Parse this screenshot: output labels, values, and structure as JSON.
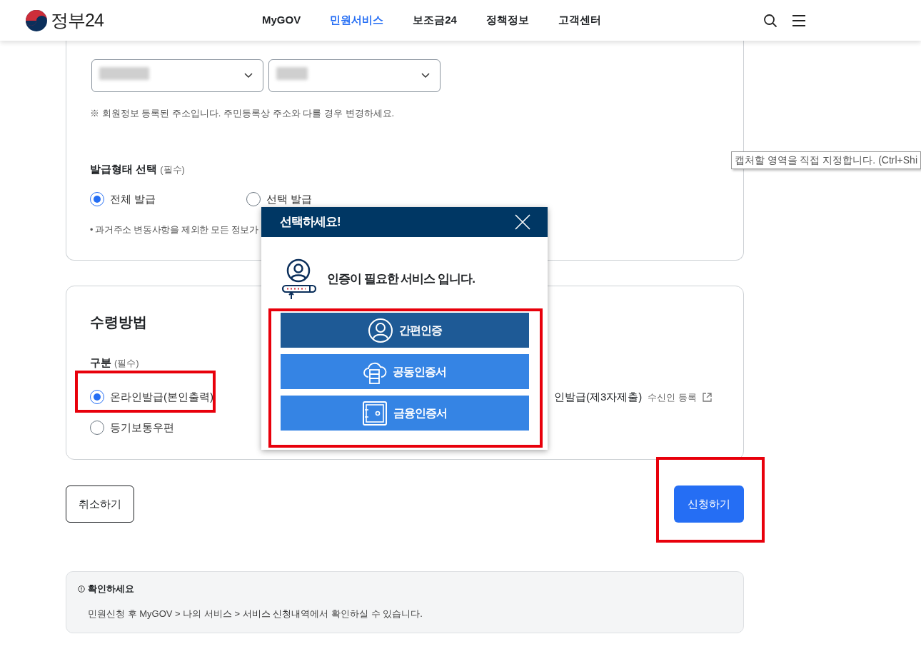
{
  "header": {
    "logo_text": "정부24",
    "nav": [
      {
        "label": "MyGOV",
        "selected": false
      },
      {
        "label": "민원서비스",
        "selected": true
      },
      {
        "label": "보조금24",
        "selected": false
      },
      {
        "label": "정책정보",
        "selected": false
      },
      {
        "label": "고객센터",
        "selected": false
      }
    ]
  },
  "address": {
    "selects": [
      {
        "redacted": true
      },
      {
        "redacted": true
      }
    ],
    "note": "※ 회원정보 등록된 주소입니다. 주민등록상 주소와 다를 경우 변경하세요."
  },
  "issue_type": {
    "label": "발급형태 선택",
    "required": "(필수)",
    "options": [
      {
        "label": "전체 발급",
        "selected": true
      },
      {
        "label": "선택 발급",
        "selected": false
      }
    ],
    "note": "• 과거주소 변동사항을 제외한 모든 정보가"
  },
  "receipt": {
    "title": "수령방법",
    "label": "구분",
    "required": "(필수)",
    "options": [
      {
        "label": "온라인발급(본인출력)",
        "selected": true
      },
      {
        "label": "등기보통우편",
        "selected": false
      }
    ],
    "third_party": {
      "label": "인발급(제3자제출)",
      "link": "수신인 등록"
    }
  },
  "actions": {
    "cancel": "취소하기",
    "submit": "신청하기"
  },
  "notice": {
    "title": "확인하세요",
    "text_before": "민원신청 후 MyGOV > 나의 서비스 > ",
    "link": "서비스 신청내역",
    "text_after": "에서 확인하실 수 있습니다."
  },
  "modal": {
    "title": "선택하세요!",
    "message": "인증이 필요한 서비스 입니다.",
    "options": [
      {
        "label": "간편인증",
        "kind": "simple"
      },
      {
        "label": "공동인증서",
        "kind": "joint"
      },
      {
        "label": "금융인증서",
        "kind": "financial"
      }
    ]
  },
  "tooltip": {
    "text": "캡처할 영역을 직접 지정합니다. (Ctrl+Shi"
  }
}
